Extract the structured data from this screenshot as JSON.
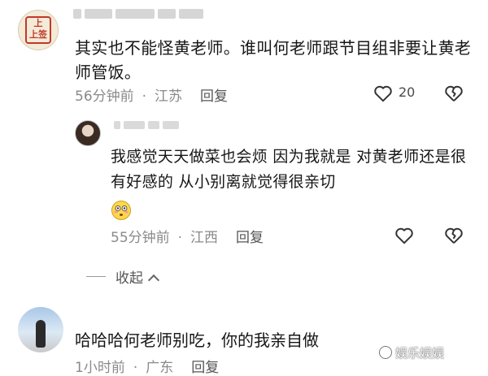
{
  "comment1": {
    "avatar_text": "上上签",
    "text": "其实也不能怪黄老师。谁叫何老师跟节目组非要让黄老师管饭。",
    "time": "56分钟前",
    "separator": "·",
    "location": "江苏",
    "reply_label": "回复",
    "like_count": "20"
  },
  "comment2": {
    "text": "我感觉天天做菜也会烦 因为我就是 对黄老师还是很有好感的 从小别离就觉得很亲切",
    "emoji": "flushed-face",
    "time": "55分钟前",
    "separator": "·",
    "location": "江西",
    "reply_label": "回复"
  },
  "collapse_label": "收起",
  "comment3": {
    "text": "哈哈哈何老师别吃，你的我亲自做",
    "time": "1小时前",
    "separator": "·",
    "location": "广东",
    "reply_label": "回复"
  },
  "watermark": "娱乐娱娱"
}
